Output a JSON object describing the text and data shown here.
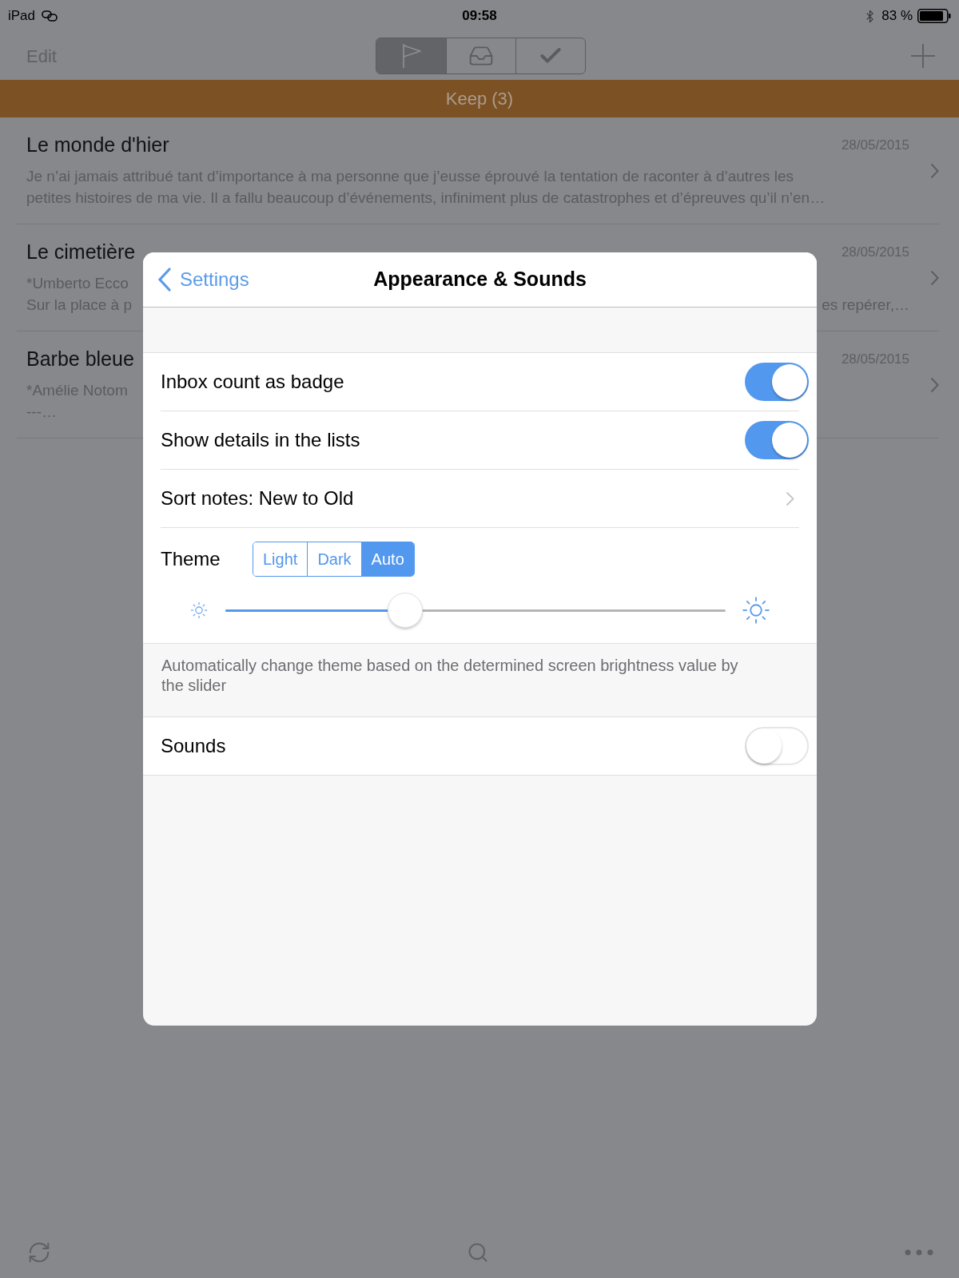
{
  "status_bar": {
    "carrier": "iPad",
    "time": "09:58",
    "battery": "83 %"
  },
  "nav_bar": {
    "edit": "Edit",
    "segments": [
      {
        "kind": "flag",
        "selected": true
      },
      {
        "kind": "inbox",
        "selected": false
      },
      {
        "kind": "check",
        "selected": false
      }
    ]
  },
  "section_header": "Keep (3)",
  "notes": [
    {
      "title": "Le monde d'hier",
      "date": "28/05/2015",
      "lines": [
        {
          "left": "Je n’ai jamais attribué tant d’importance à ma personne que j’eusse éprouvé la tentation de raconter à d’autres les"
        },
        {
          "left": "petites histoires de ma vie. Il a fallu beaucoup d’événements, infiniment plus de catastrophes et d’épreuves qu’il n’en…"
        }
      ]
    },
    {
      "title": "Le cimetière",
      "date": "28/05/2015",
      "lines": [
        {
          "left": "*Umberto Ecco"
        },
        {
          "left": "Sur la place à p",
          "right": "es repérer,…"
        }
      ]
    },
    {
      "title": "Barbe bleue",
      "date": "28/05/2015",
      "lines": [
        {
          "left": "*Amélie Notom"
        },
        {
          "left": "---…"
        }
      ]
    }
  ],
  "modal": {
    "back": "Settings",
    "title": "Appearance & Sounds",
    "rows": [
      {
        "kind": "toggle",
        "label": "Inbox count as badge",
        "on": true
      },
      {
        "kind": "toggle",
        "label": "Show details in the lists",
        "on": true
      },
      {
        "kind": "link",
        "label": "Sort notes: New to Old"
      },
      {
        "kind": "theme",
        "label": "Theme",
        "options": [
          {
            "label": "Light",
            "selected": false
          },
          {
            "label": "Dark",
            "selected": false
          },
          {
            "label": "Auto",
            "selected": true
          }
        ],
        "level": 0.36
      },
      {
        "kind": "footer",
        "text": "Automatically change theme based on the determined screen brightness value by the slider"
      },
      {
        "kind": "toggle",
        "label": "Sounds",
        "on": false
      }
    ]
  }
}
